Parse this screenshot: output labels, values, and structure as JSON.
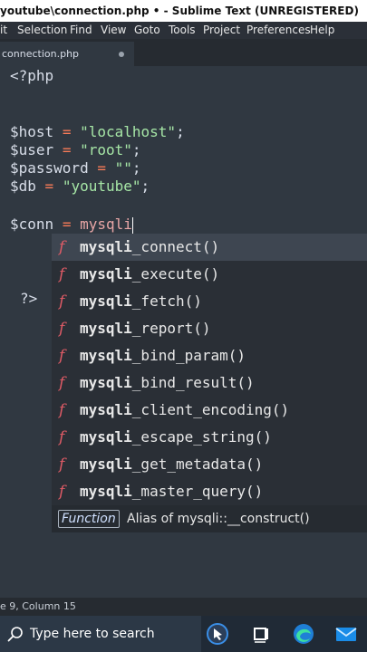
{
  "window": {
    "title": "youtube\\connection.php • - Sublime Text (UNREGISTERED)"
  },
  "menu": [
    "it",
    "Selection",
    "Find",
    "View",
    "Goto",
    "Tools",
    "Project",
    "Preferences",
    "Help"
  ],
  "tab": {
    "label": "connection.php"
  },
  "code": {
    "line1": "<?php",
    "host_var": "$host",
    "host_val": "\"localhost\"",
    "user_var": "$user",
    "user_val": "\"root\"",
    "password_var": "$password",
    "password_val": "\"\"",
    "db_var": "$db",
    "db_val": "\"youtube\"",
    "conn_var": "$conn",
    "conn_typed": "mysqli",
    "close_tag": "?>"
  },
  "autocomplete": {
    "prefix": "mysqli",
    "glyph": "f",
    "items": [
      "_connect()",
      "_execute()",
      "_fetch()",
      "_report()",
      "_bind_param()",
      "_bind_result()",
      "_client_encoding()",
      "_escape_string()",
      "_get_metadata()",
      "_master_query()"
    ],
    "detail_kind": "Function",
    "detail_text": "Alias of mysqli::__construct()"
  },
  "status": {
    "position": "e 9, Column 15"
  },
  "taskbar": {
    "search_placeholder": "Type here to search"
  }
}
